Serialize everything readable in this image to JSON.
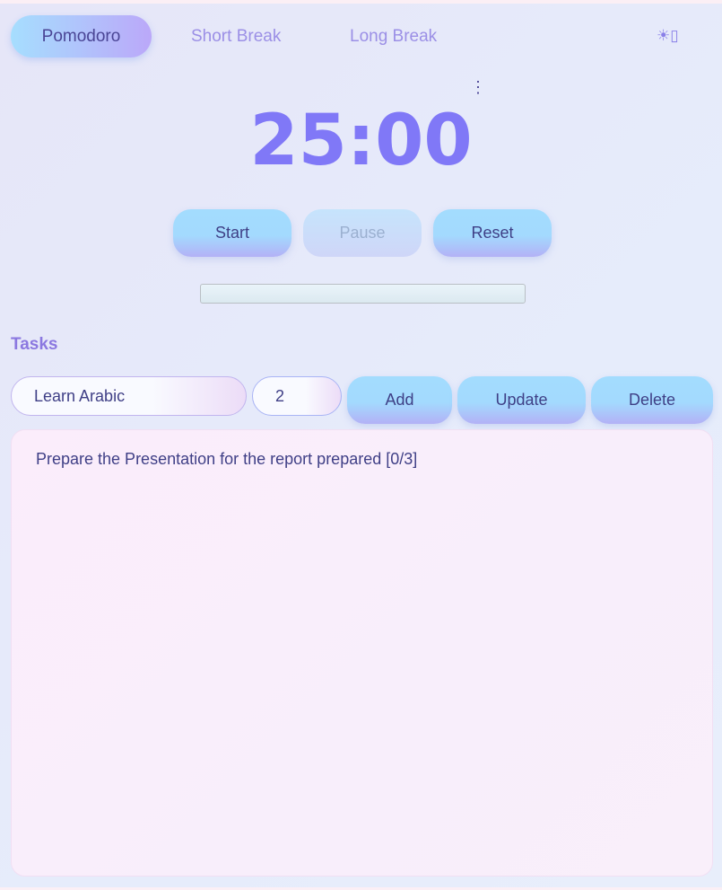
{
  "tabs": [
    {
      "label": "Pomodoro",
      "active": true
    },
    {
      "label": "Short Break",
      "active": false
    },
    {
      "label": "Long Break",
      "active": false
    }
  ],
  "theme_toggle": {
    "label": "☀▯",
    "icon": "sun-icon"
  },
  "menu": {
    "label": "⋮",
    "icon": "more-vertical-icon"
  },
  "timer": {
    "display": "25:00",
    "progress_percent": 0
  },
  "controls": {
    "start": "Start",
    "pause": "Pause",
    "reset": "Reset"
  },
  "tasks": {
    "heading": "Tasks",
    "task_input_value": "Learn Arabic",
    "count_input_value": "2",
    "add": "Add",
    "update": "Update",
    "delete": "Delete",
    "items": [
      {
        "text": "Prepare the Presentation for the report prepared [0/3]"
      }
    ]
  },
  "colors": {
    "accent": "#8078f7",
    "text": "#3f3f86"
  }
}
